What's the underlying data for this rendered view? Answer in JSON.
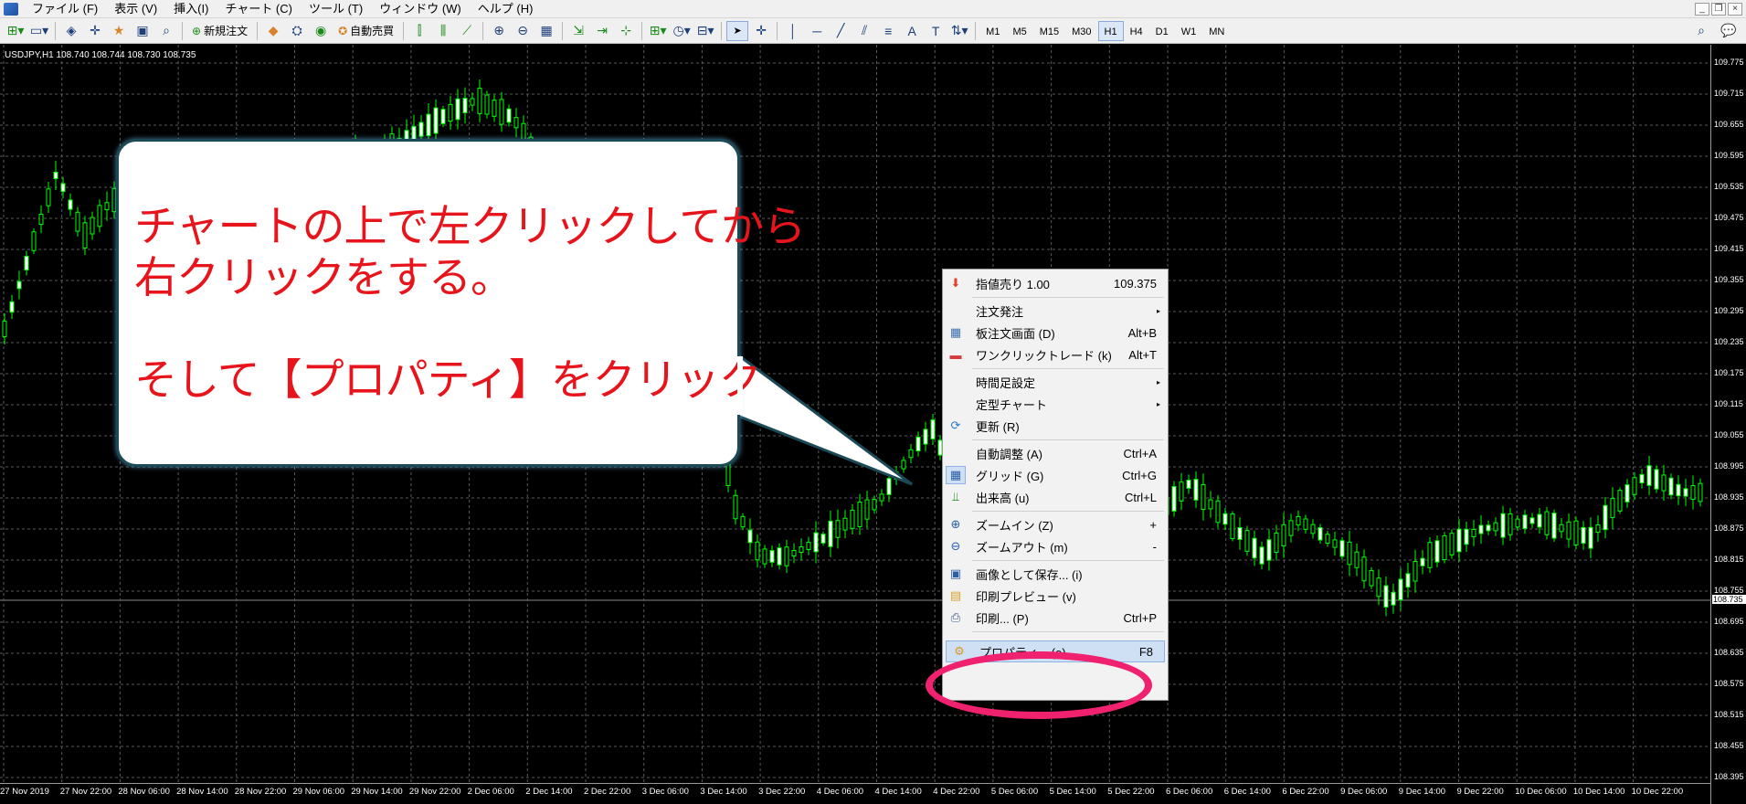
{
  "menubar": {
    "items": [
      "ファイル (F)",
      "表示 (V)",
      "挿入(I)",
      "チャート (C)",
      "ツール (T)",
      "ウィンドウ (W)",
      "ヘルプ (H)"
    ]
  },
  "toolbar": {
    "new_order_label": "新規注文",
    "auto_trade_label": "自動売買",
    "timeframes": [
      "M1",
      "M5",
      "M15",
      "M30",
      "H1",
      "H4",
      "D1",
      "W1",
      "MN"
    ],
    "active_timeframe": "H1"
  },
  "chart": {
    "header": "USDJPY,H1  108.740 108.744 108.730 108.735",
    "current_price": "108.735",
    "bg_color": "#000000",
    "grid_color": "#5a5a5a",
    "up_color": "#00ff00",
    "down_color": "#ffffff",
    "y_ticks": [
      "109.775",
      "109.715",
      "109.655",
      "109.595",
      "109.535",
      "109.475",
      "109.415",
      "109.355",
      "109.295",
      "109.235",
      "109.175",
      "109.115",
      "109.055",
      "108.995",
      "108.935",
      "108.875",
      "108.815",
      "108.755",
      "108.695",
      "108.635",
      "108.575",
      "108.515",
      "108.455",
      "108.395"
    ],
    "x_ticks": [
      "27 Nov 2019",
      "27 Nov 22:00",
      "28 Nov 06:00",
      "28 Nov 14:00",
      "28 Nov 22:00",
      "29 Nov 06:00",
      "29 Nov 14:00",
      "29 Nov 22:00",
      "2 Dec 06:00",
      "2 Dec 14:00",
      "2 Dec 22:00",
      "3 Dec 06:00",
      "3 Dec 14:00",
      "3 Dec 22:00",
      "4 Dec 06:00",
      "4 Dec 14:00",
      "4 Dec 22:00",
      "5 Dec 06:00",
      "5 Dec 14:00",
      "5 Dec 22:00",
      "6 Dec 06:00",
      "6 Dec 14:00",
      "6 Dec 22:00",
      "9 Dec 06:00",
      "9 Dec 14:00",
      "9 Dec 22:00",
      "10 Dec 06:00",
      "10 Dec 14:00",
      "10 Dec 22:00"
    ]
  },
  "callout": {
    "line1": "チャートの上で左クリックしてから",
    "line2": "右クリックをする。",
    "line3": "そして【プロパティ】をクリック",
    "text_color": "#e8141b"
  },
  "context_menu": {
    "items": [
      {
        "label": "指値売り 1.00",
        "shortcut": "109.375",
        "icon": "sell-arrow-icon"
      },
      {
        "label": "注文発注",
        "shortcut": "",
        "submenu": true
      },
      {
        "label": "板注文画面 (D)",
        "shortcut": "Alt+B",
        "icon": "order-board-icon"
      },
      {
        "label": "ワンクリックトレード (k)",
        "shortcut": "Alt+T",
        "icon": "one-click-trade-icon"
      },
      {
        "label": "時間足設定",
        "shortcut": "",
        "submenu": true
      },
      {
        "label": "定型チャート",
        "shortcut": "",
        "submenu": true
      },
      {
        "label": "更新 (R)",
        "shortcut": "",
        "icon": "refresh-icon"
      },
      {
        "label": "自動調整 (A)",
        "shortcut": "Ctrl+A"
      },
      {
        "label": "グリッド (G)",
        "shortcut": "Ctrl+G",
        "icon": "grid-icon"
      },
      {
        "label": "出来高 (u)",
        "shortcut": "Ctrl+L",
        "icon": "volume-icon"
      },
      {
        "label": "ズームイン (Z)",
        "shortcut": "+",
        "icon": "zoom-in-icon"
      },
      {
        "label": "ズームアウト (m)",
        "shortcut": "-",
        "icon": "zoom-out-icon"
      },
      {
        "label": "画像として保存... (i)",
        "shortcut": "",
        "icon": "save-image-icon"
      },
      {
        "label": "印刷プレビュー (v)",
        "shortcut": "",
        "icon": "print-preview-icon"
      },
      {
        "label": "印刷... (P)",
        "shortcut": "Ctrl+P",
        "icon": "print-icon"
      },
      {
        "label": "プロパティ... (o)",
        "shortcut": "F8",
        "icon": "properties-icon"
      }
    ]
  },
  "highlight_color": "#f0226f"
}
